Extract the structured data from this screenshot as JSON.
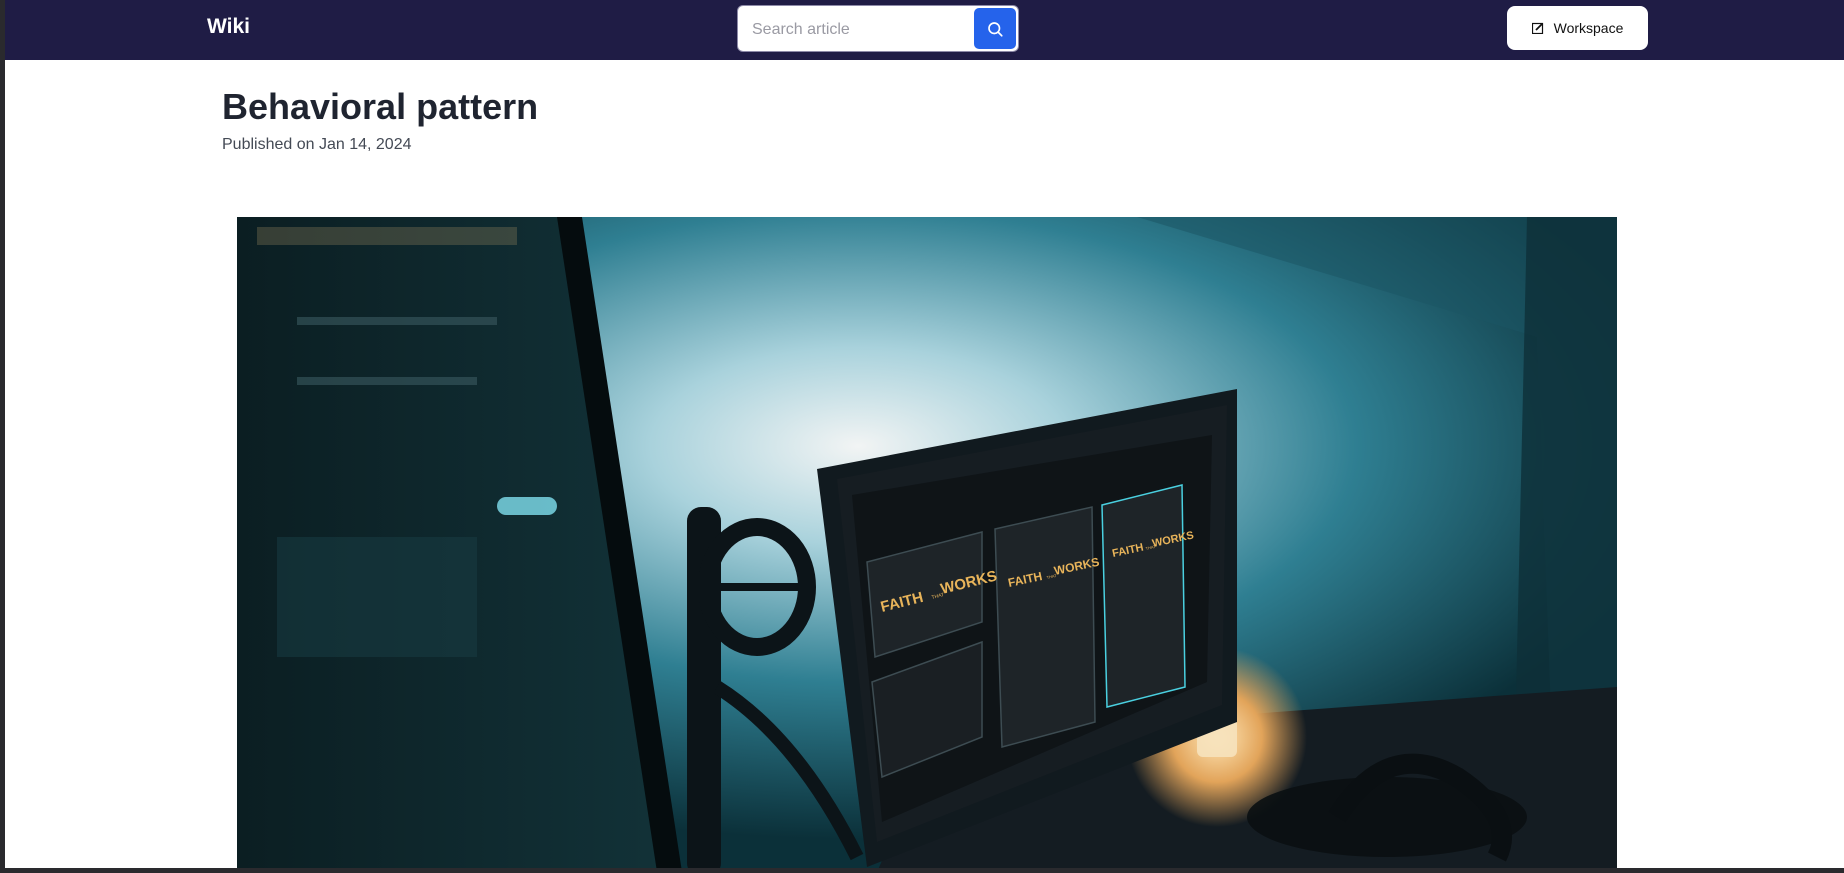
{
  "header": {
    "brand": "Wiki",
    "search": {
      "placeholder": "Search article"
    },
    "workspace_label": "Workspace"
  },
  "article": {
    "title": "Behavioral pattern",
    "published": "Published on Jan 14, 2024",
    "hero_image": {
      "panels": [
        {
          "line1": "FAITH",
          "small": "THAT",
          "line2": "WORKS"
        },
        {
          "line1": "FAITH",
          "small": "THAT",
          "line2": "WORKS"
        },
        {
          "line1": "FAITH",
          "small": "THAT",
          "line2": "WORKS"
        }
      ]
    }
  },
  "colors": {
    "topbar": "#1f1c45",
    "search_button": "#2563eb",
    "accent_text": "#e8b45a"
  }
}
